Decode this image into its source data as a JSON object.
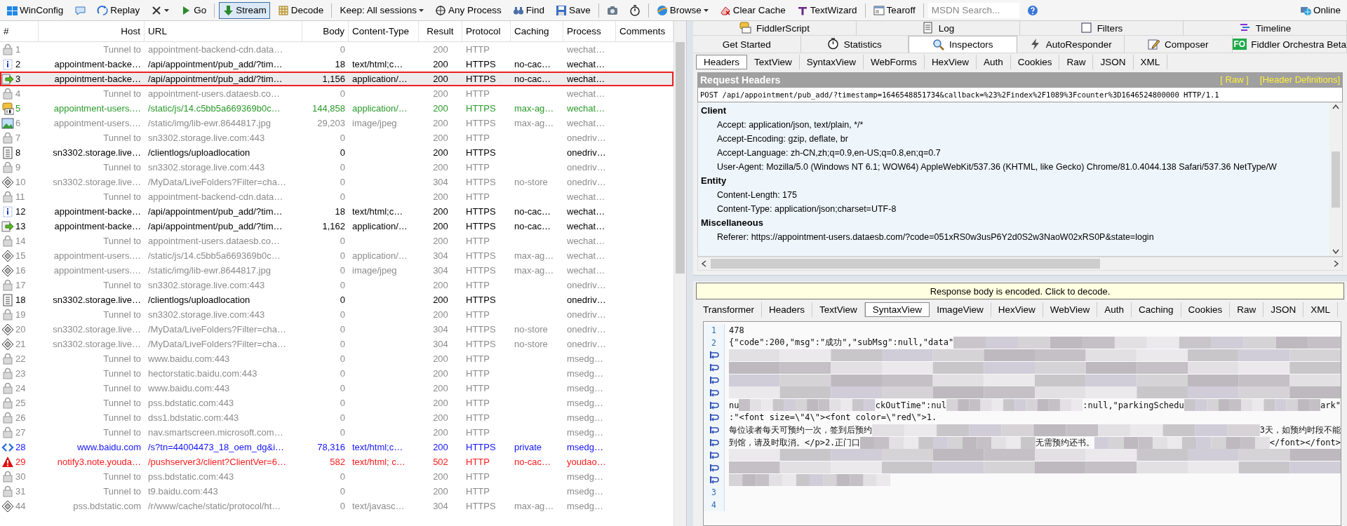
{
  "toolbar": [
    {
      "kind": "winconfig",
      "label": "WinConfig",
      "pressed": false
    },
    {
      "kind": "comment",
      "pressed": false
    },
    {
      "kind": "replay",
      "label": "Replay",
      "pressed": false
    },
    {
      "kind": "remove",
      "caret": true,
      "pressed": false
    },
    {
      "kind": "go",
      "label": "Go",
      "pressed": false
    },
    {
      "kind": "stream",
      "label": "Stream",
      "pressed": true
    },
    {
      "kind": "decode",
      "label": "Decode",
      "pressed": false
    },
    {
      "kind": "keep",
      "label": "Keep: All sessions",
      "caret": true,
      "pressed": false
    },
    {
      "kind": "process",
      "label": "Any Process",
      "pressed": false
    },
    {
      "kind": "find",
      "label": "Find",
      "pressed": false
    },
    {
      "kind": "save",
      "label": "Save",
      "pressed": false
    },
    {
      "kind": "screenshot",
      "pressed": false
    },
    {
      "kind": "timer",
      "pressed": false
    },
    {
      "kind": "browse",
      "label": "Browse",
      "caret": true,
      "pressed": false
    },
    {
      "kind": "clearcache",
      "label": "Clear Cache",
      "pressed": false
    },
    {
      "kind": "textwizard",
      "label": "TextWizard",
      "pressed": false
    },
    {
      "kind": "tearoff",
      "label": "Tearoff",
      "pressed": false
    },
    {
      "kind": "search",
      "placeholder": "MSDN Search..."
    },
    {
      "kind": "help",
      "pressed": false
    },
    {
      "kind": "online",
      "label": "Online",
      "pressed": false
    }
  ],
  "sessions": {
    "columns": [
      "#",
      "Host",
      "URL",
      "Body",
      "Content-Type",
      "Result",
      "Protocol",
      "Caching",
      "Process",
      "Comments"
    ],
    "rows": [
      {
        "number": "1",
        "kind": "tunnel",
        "color": "#8c8c8c",
        "selected": false,
        "host": "Tunnel to",
        "url": "appointment-backend-cdn.data…",
        "body": "0",
        "result": "200",
        "protocol": "HTTP",
        "process": "wechat…"
      },
      {
        "number": "2",
        "kind": "info",
        "color": "#000000",
        "selected": false,
        "host": "appointment-backe…",
        "url": "/api/appointment/pub_add/?tim…",
        "body": "18",
        "content_type": "text/html;c…",
        "result": "200",
        "protocol": "HTTPS",
        "caching": "no-cac…",
        "process": "wechat…"
      },
      {
        "number": "3",
        "kind": "response",
        "color": "#000000",
        "selected": true,
        "host": "appointment-backe…",
        "url": "/api/appointment/pub_add/?tim…",
        "body": "1,156",
        "content_type": "application/…",
        "result": "200",
        "protocol": "HTTPS",
        "caching": "no-cac…",
        "process": "wechat…"
      },
      {
        "number": "4",
        "kind": "tunnel",
        "color": "#8c8c8c",
        "selected": false,
        "host": "Tunnel to",
        "url": "appointment-users.dataesb.co…",
        "body": "0",
        "result": "200",
        "protocol": "HTTP",
        "process": "wechat…"
      },
      {
        "number": "5",
        "kind": "script",
        "color": "#2a9a2a",
        "selected": false,
        "host": "appointment-users.…",
        "url": "/static/js/14.c5bb5a669369b0c…",
        "body": "144,858",
        "content_type": "application/…",
        "result": "200",
        "protocol": "HTTPS",
        "caching": "max-ag…",
        "process": "wechat…"
      },
      {
        "number": "6",
        "kind": "image",
        "color": "#8c8c8c",
        "selected": false,
        "host": "appointment-users.…",
        "url": "/static/img/lib-ewr.8644817.jpg",
        "body": "29,203",
        "content_type": "image/jpeg",
        "result": "200",
        "protocol": "HTTPS",
        "caching": "max-ag…",
        "process": "wechat…"
      },
      {
        "number": "7",
        "kind": "tunnel",
        "color": "#8c8c8c",
        "selected": false,
        "host": "Tunnel to",
        "url": "sn3302.storage.live.com:443",
        "body": "0",
        "result": "200",
        "protocol": "HTTP",
        "process": "onedriv…"
      },
      {
        "number": "8",
        "kind": "document",
        "color": "#000000",
        "selected": false,
        "host": "sn3302.storage.live…",
        "url": "/clientlogs/uploadlocation",
        "body": "0",
        "result": "200",
        "protocol": "HTTPS",
        "process": "onedriv…"
      },
      {
        "number": "9",
        "kind": "tunnel",
        "color": "#8c8c8c",
        "selected": false,
        "host": "Tunnel to",
        "url": "sn3302.storage.live.com:443",
        "body": "0",
        "result": "200",
        "protocol": "HTTP",
        "process": "onedriv…"
      },
      {
        "number": "10",
        "kind": "cached",
        "color": "#8c8c8c",
        "selected": false,
        "host": "sn3302.storage.live…",
        "url": "/MyData/LiveFolders?Filter=cha…",
        "body": "0",
        "result": "304",
        "protocol": "HTTPS",
        "caching": "no-store",
        "process": "onedriv…"
      },
      {
        "number": "11",
        "kind": "tunnel",
        "color": "#8c8c8c",
        "selected": false,
        "host": "Tunnel to",
        "url": "appointment-backend-cdn.data…",
        "body": "0",
        "result": "200",
        "protocol": "HTTP",
        "process": "wechat…"
      },
      {
        "number": "12",
        "kind": "info",
        "color": "#000000",
        "selected": false,
        "host": "appointment-backe…",
        "url": "/api/appointment/pub_add/?tim…",
        "body": "18",
        "content_type": "text/html;c…",
        "result": "200",
        "protocol": "HTTPS",
        "caching": "no-cac…",
        "process": "wechat…"
      },
      {
        "number": "13",
        "kind": "response",
        "color": "#000000",
        "selected": false,
        "host": "appointment-backe…",
        "url": "/api/appointment/pub_add/?tim…",
        "body": "1,162",
        "content_type": "application/…",
        "result": "200",
        "protocol": "HTTPS",
        "caching": "no-cac…",
        "process": "wechat…"
      },
      {
        "number": "14",
        "kind": "tunnel",
        "color": "#8c8c8c",
        "selected": false,
        "host": "Tunnel to",
        "url": "appointment-users.dataesb.co…",
        "body": "0",
        "result": "200",
        "protocol": "HTTP",
        "process": "wechat…"
      },
      {
        "number": "15",
        "kind": "cached",
        "color": "#8c8c8c",
        "selected": false,
        "host": "appointment-users.…",
        "url": "/static/js/14.c5bb5a669369b0c…",
        "body": "0",
        "content_type": "application/…",
        "result": "304",
        "protocol": "HTTPS",
        "caching": "max-ag…",
        "process": "wechat…"
      },
      {
        "number": "16",
        "kind": "cached",
        "color": "#8c8c8c",
        "selected": false,
        "host": "appointment-users.…",
        "url": "/static/img/lib-ewr.8644817.jpg",
        "body": "0",
        "content_type": "image/jpeg",
        "result": "304",
        "protocol": "HTTPS",
        "caching": "max-ag…",
        "process": "wechat…"
      },
      {
        "number": "17",
        "kind": "tunnel",
        "color": "#8c8c8c",
        "selected": false,
        "host": "Tunnel to",
        "url": "sn3302.storage.live.com:443",
        "body": "0",
        "result": "200",
        "protocol": "HTTP",
        "process": "onedriv…"
      },
      {
        "number": "18",
        "kind": "document",
        "color": "#000000",
        "selected": false,
        "host": "sn3302.storage.live…",
        "url": "/clientlogs/uploadlocation",
        "body": "0",
        "result": "200",
        "protocol": "HTTPS",
        "process": "onedriv…"
      },
      {
        "number": "19",
        "kind": "tunnel",
        "color": "#8c8c8c",
        "selected": false,
        "host": "Tunnel to",
        "url": "sn3302.storage.live.com:443",
        "body": "0",
        "result": "200",
        "protocol": "HTTP",
        "process": "onedriv…"
      },
      {
        "number": "20",
        "kind": "cached",
        "color": "#8c8c8c",
        "selected": false,
        "host": "sn3302.storage.live…",
        "url": "/MyData/LiveFolders?Filter=cha…",
        "body": "0",
        "result": "304",
        "protocol": "HTTPS",
        "caching": "no-store",
        "process": "onedriv…"
      },
      {
        "number": "21",
        "kind": "cached",
        "color": "#8c8c8c",
        "selected": false,
        "host": "sn3302.storage.live…",
        "url": "/MyData/LiveFolders?Filter=cha…",
        "body": "0",
        "result": "304",
        "protocol": "HTTPS",
        "caching": "no-store",
        "process": "onedriv…"
      },
      {
        "number": "22",
        "kind": "tunnel",
        "color": "#8c8c8c",
        "selected": false,
        "host": "Tunnel to",
        "url": "www.baidu.com:443",
        "body": "0",
        "result": "200",
        "protocol": "HTTP",
        "process": "msedg…"
      },
      {
        "number": "23",
        "kind": "tunnel",
        "color": "#8c8c8c",
        "selected": false,
        "host": "Tunnel to",
        "url": "hectorstatic.baidu.com:443",
        "body": "0",
        "result": "200",
        "protocol": "HTTP",
        "process": "msedg…"
      },
      {
        "number": "24",
        "kind": "tunnel",
        "color": "#8c8c8c",
        "selected": false,
        "host": "Tunnel to",
        "url": "www.baidu.com:443",
        "body": "0",
        "result": "200",
        "protocol": "HTTP",
        "process": "msedg…"
      },
      {
        "number": "25",
        "kind": "tunnel",
        "color": "#8c8c8c",
        "selected": false,
        "host": "Tunnel to",
        "url": "pss.bdstatic.com:443",
        "body": "0",
        "result": "200",
        "protocol": "HTTP",
        "process": "msedg…"
      },
      {
        "number": "26",
        "kind": "tunnel",
        "color": "#8c8c8c",
        "selected": false,
        "host": "Tunnel to",
        "url": "dss1.bdstatic.com:443",
        "body": "0",
        "result": "200",
        "protocol": "HTTP",
        "process": "msedg…"
      },
      {
        "number": "27",
        "kind": "tunnel",
        "color": "#8c8c8c",
        "selected": false,
        "host": "Tunnel to",
        "url": "nav.smartscreen.microsoft.com…",
        "body": "0",
        "result": "200",
        "protocol": "HTTP",
        "process": "msedg…"
      },
      {
        "number": "28",
        "kind": "html",
        "color": "#1414ff",
        "selected": false,
        "host": "www.baidu.com",
        "url": "/s?tn=44004473_18_oem_dg&i…",
        "body": "78,316",
        "content_type": "text/html;c…",
        "result": "200",
        "protocol": "HTTPS",
        "caching": "private",
        "process": "msedg…"
      },
      {
        "number": "29",
        "kind": "error",
        "color": "#ff1a1a",
        "selected": false,
        "host": "notify3.note.youda…",
        "url": "/pushserver3/client?ClientVer=6…",
        "body": "582",
        "content_type": "text/html; c…",
        "result": "502",
        "protocol": "HTTP",
        "caching": "no-cac…",
        "process": "youdao…"
      },
      {
        "number": "30",
        "kind": "tunnel",
        "color": "#8c8c8c",
        "selected": false,
        "host": "Tunnel to",
        "url": "pss.bdstatic.com:443",
        "body": "0",
        "result": "200",
        "protocol": "HTTP",
        "process": "msedg…"
      },
      {
        "number": "31",
        "kind": "tunnel",
        "color": "#8c8c8c",
        "selected": false,
        "host": "Tunnel to",
        "url": "t9.baidu.com:443",
        "body": "0",
        "result": "200",
        "protocol": "HTTP",
        "process": "msedg…"
      },
      {
        "number": "44",
        "kind": "cached",
        "color": "#8c8c8c",
        "selected": false,
        "host": "pss.bdstatic.com",
        "url": "/r/www/cache/static/protocol/ht…",
        "body": "0",
        "content_type": "text/javasc…",
        "result": "304",
        "protocol": "HTTPS",
        "caching": "max-ag…",
        "process": "msedg…"
      }
    ]
  },
  "main_tabs": [
    [
      {
        "kind": "script",
        "label": "FiddlerScript",
        "selected": false
      },
      {
        "kind": "log",
        "label": "Log",
        "selected": false
      },
      {
        "kind": "checkbox",
        "label": "Filters",
        "selected": false
      },
      {
        "kind": "timeline",
        "label": "Timeline",
        "selected": false
      }
    ],
    [
      {
        "kind": "plain",
        "label": "Get Started",
        "selected": false
      },
      {
        "kind": "stopwatch",
        "label": "Statistics",
        "selected": false
      },
      {
        "kind": "inspect",
        "label": "Inspectors",
        "selected": true
      },
      {
        "kind": "bolt",
        "label": "AutoResponder",
        "selected": false
      },
      {
        "kind": "compose",
        "label": "Composer",
        "selected": false
      },
      {
        "kind": "orchestra",
        "badge": "FO",
        "label": "Fiddler Orchestra Beta",
        "selected": false
      }
    ]
  ],
  "request": {
    "tabs": [
      {
        "label": "Headers",
        "selected": true
      },
      {
        "label": "TextView",
        "selected": false
      },
      {
        "label": "SyntaxView",
        "selected": false
      },
      {
        "label": "WebForms",
        "selected": false
      },
      {
        "label": "HexView",
        "selected": false
      },
      {
        "label": "Auth",
        "selected": false
      },
      {
        "label": "Cookies",
        "selected": false
      },
      {
        "label": "Raw",
        "selected": false
      },
      {
        "label": "JSON",
        "selected": false
      },
      {
        "label": "XML",
        "selected": false
      }
    ],
    "title": "Request Headers",
    "links": [
      "[ Raw ]",
      "[Header Definitions]"
    ],
    "request_line": "POST /api/appointment/pub_add/?timestamp=1646548851734&callback=%23%2Findex%2F1089%3Fcounter%3D1646524800000 HTTP/1.1",
    "groups": [
      {
        "name": "Client",
        "headers": [
          "Accept: application/json, text/plain, */*",
          "Accept-Encoding: gzip, deflate, br",
          "Accept-Language: zh-CN,zh;q=0.9,en-US;q=0.8,en;q=0.7",
          "User-Agent: Mozilla/5.0 (Windows NT 6.1; WOW64) AppleWebKit/537.36 (KHTML, like Gecko) Chrome/81.0.4044.138 Safari/537.36 NetType/W"
        ]
      },
      {
        "name": "Entity",
        "headers": [
          "Content-Length: 175",
          "Content-Type: application/json;charset=UTF-8"
        ]
      },
      {
        "name": "Miscellaneous",
        "headers": [
          "Referer: https://appointment-users.dataesb.com/?code=051xRS0w3usP6Y2d0S2w3NaoW02xRS0P&state=login"
        ]
      }
    ]
  },
  "response": {
    "notice": "Response body is encoded. Click to decode.",
    "tabs": [
      {
        "label": "Transformer",
        "selected": false
      },
      {
        "label": "Headers",
        "selected": false
      },
      {
        "label": "TextView",
        "selected": false
      },
      {
        "label": "SyntaxView",
        "selected": true
      },
      {
        "label": "ImageView",
        "selected": false
      },
      {
        "label": "HexView",
        "selected": false
      },
      {
        "label": "WebView",
        "selected": false
      },
      {
        "label": "Auth",
        "selected": false
      },
      {
        "label": "Caching",
        "selected": false
      },
      {
        "label": "Cookies",
        "selected": false
      },
      {
        "label": "Raw",
        "selected": false
      },
      {
        "label": "JSON",
        "selected": false
      },
      {
        "label": "XML",
        "selected": false
      }
    ],
    "code_lines": [
      {
        "kind": "number",
        "number": "1",
        "parts": [
          {
            "kind": "text",
            "text": "478"
          }
        ]
      },
      {
        "kind": "number",
        "number": "2",
        "parts": [
          {
            "kind": "text",
            "text": "{\"code\":200,\"msg\":\"成功\",\"subMsg\":null,\"data\""
          },
          {
            "kind": "blur"
          }
        ]
      },
      {
        "kind": "wrap",
        "parts": [
          {
            "kind": "blur"
          }
        ]
      },
      {
        "kind": "wrap",
        "parts": [
          {
            "kind": "blur"
          }
        ]
      },
      {
        "kind": "wrap",
        "parts": [
          {
            "kind": "blur"
          }
        ]
      },
      {
        "kind": "wrap",
        "parts": [
          {
            "kind": "blur"
          }
        ]
      },
      {
        "kind": "wrap",
        "parts": [
          {
            "kind": "text",
            "text": "nu"
          },
          {
            "kind": "blur"
          },
          {
            "kind": "text",
            "text": "ckOutTime\":nul"
          },
          {
            "kind": "blur"
          },
          {
            "kind": "text",
            "text": ":null,\"parkingSchedu"
          },
          {
            "kind": "blur"
          },
          {
            "kind": "text",
            "text": "ark\""
          }
        ]
      },
      {
        "kind": "wrap",
        "parts": [
          {
            "kind": "text",
            "text": ":\"<font size=\\\"4\\\"><font color=\\\"red\\\">1."
          }
        ]
      },
      {
        "kind": "wrap",
        "parts": [
          {
            "kind": "text",
            "text": "每位读者每天可预约一次，签到后预约"
          },
          {
            "kind": "blur"
          },
          {
            "kind": "text",
            "text": "3天，如预约时段不能"
          }
        ]
      },
      {
        "kind": "wrap",
        "parts": [
          {
            "kind": "text",
            "text": "到馆，请及时取消。</p>2.正门口"
          },
          {
            "kind": "blur"
          },
          {
            "kind": "text",
            "text": "无需预约还书。"
          },
          {
            "kind": "blur"
          },
          {
            "kind": "text",
            "text": "</font></font>"
          }
        ]
      },
      {
        "kind": "wrap",
        "parts": [
          {
            "kind": "blur"
          }
        ]
      },
      {
        "kind": "wrap",
        "parts": [
          {
            "kind": "blur"
          }
        ]
      },
      {
        "kind": "wrap",
        "parts": [
          {
            "kind": "blur",
            "short": true
          }
        ]
      },
      {
        "kind": "number",
        "number": "3"
      },
      {
        "kind": "number",
        "number": "4"
      }
    ]
  }
}
